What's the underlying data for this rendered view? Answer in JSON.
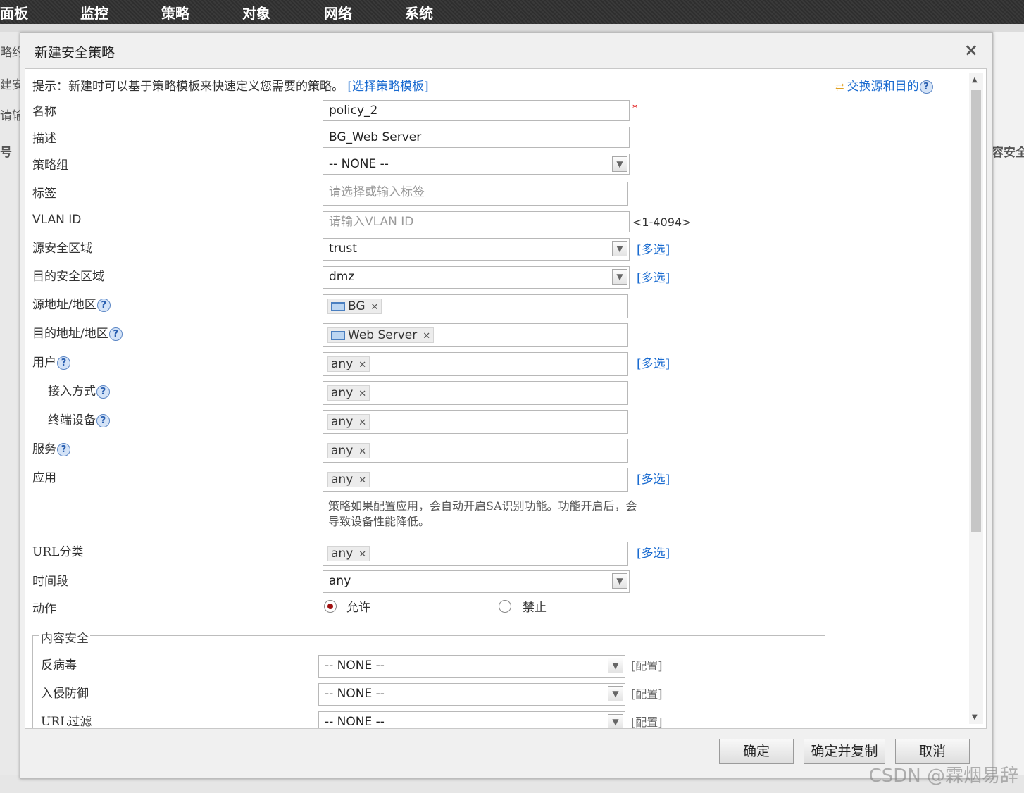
{
  "menu": [
    "面板",
    "监控",
    "策略",
    "对象",
    "网络",
    "系统"
  ],
  "background": {
    "left_fragments": [
      "略约",
      "建安",
      "请输",
      "号"
    ],
    "right_fragment": "容安全"
  },
  "dialog": {
    "title": "新建安全策略",
    "close": "×",
    "hint_text": "提示：新建时可以基于策略模板来快速定义您需要的策略。",
    "hint_link": "[选择策略模板]",
    "swap_link": "交换源和目的",
    "labels": {
      "name": "名称",
      "desc": "描述",
      "group": "策略组",
      "tags": "标签",
      "vlan": "VLAN ID",
      "src_zone": "源安全区域",
      "dst_zone": "目的安全区域",
      "src_addr": "源地址/地区",
      "dst_addr": "目的地址/地区",
      "user": "用户",
      "access": "接入方式",
      "terminal": "终端设备",
      "service": "服务",
      "app": "应用",
      "url": "URL分类",
      "time": "时间段",
      "action": "动作"
    },
    "values": {
      "name": "policy_2",
      "desc": "BG_Web Server",
      "group": "-- NONE --",
      "tags_placeholder": "请选择或输入标签",
      "vlan_placeholder": "请输入VLAN ID",
      "vlan_range": "<1-4094>",
      "src_zone": "trust",
      "dst_zone": "dmz",
      "src_addr": "BG",
      "dst_addr": "Web Server",
      "user": "any",
      "access": "any",
      "terminal": "any",
      "service": "any",
      "app": "any",
      "url": "any",
      "time": "any",
      "action_allow": "允许",
      "action_deny": "禁止"
    },
    "required_mark": "*",
    "multi_link": "[多选]",
    "remove_x": "✕",
    "app_desc": "策略如果配置应用，会自动开启SA识别功能。功能开启后，会导致设备性能降低。",
    "content_security": {
      "legend": "内容安全",
      "rows": [
        {
          "label": "反病毒",
          "value": "-- NONE --",
          "config": "[配置]"
        },
        {
          "label": "入侵防御",
          "value": "-- NONE --",
          "config": "[配置]"
        },
        {
          "label": "URL过滤",
          "value": "-- NONE --",
          "config": "[配置]"
        }
      ]
    },
    "buttons": {
      "ok": "确定",
      "ok_copy": "确定并复制",
      "cancel": "取消"
    }
  },
  "watermark": "CSDN @霖烟易辞"
}
